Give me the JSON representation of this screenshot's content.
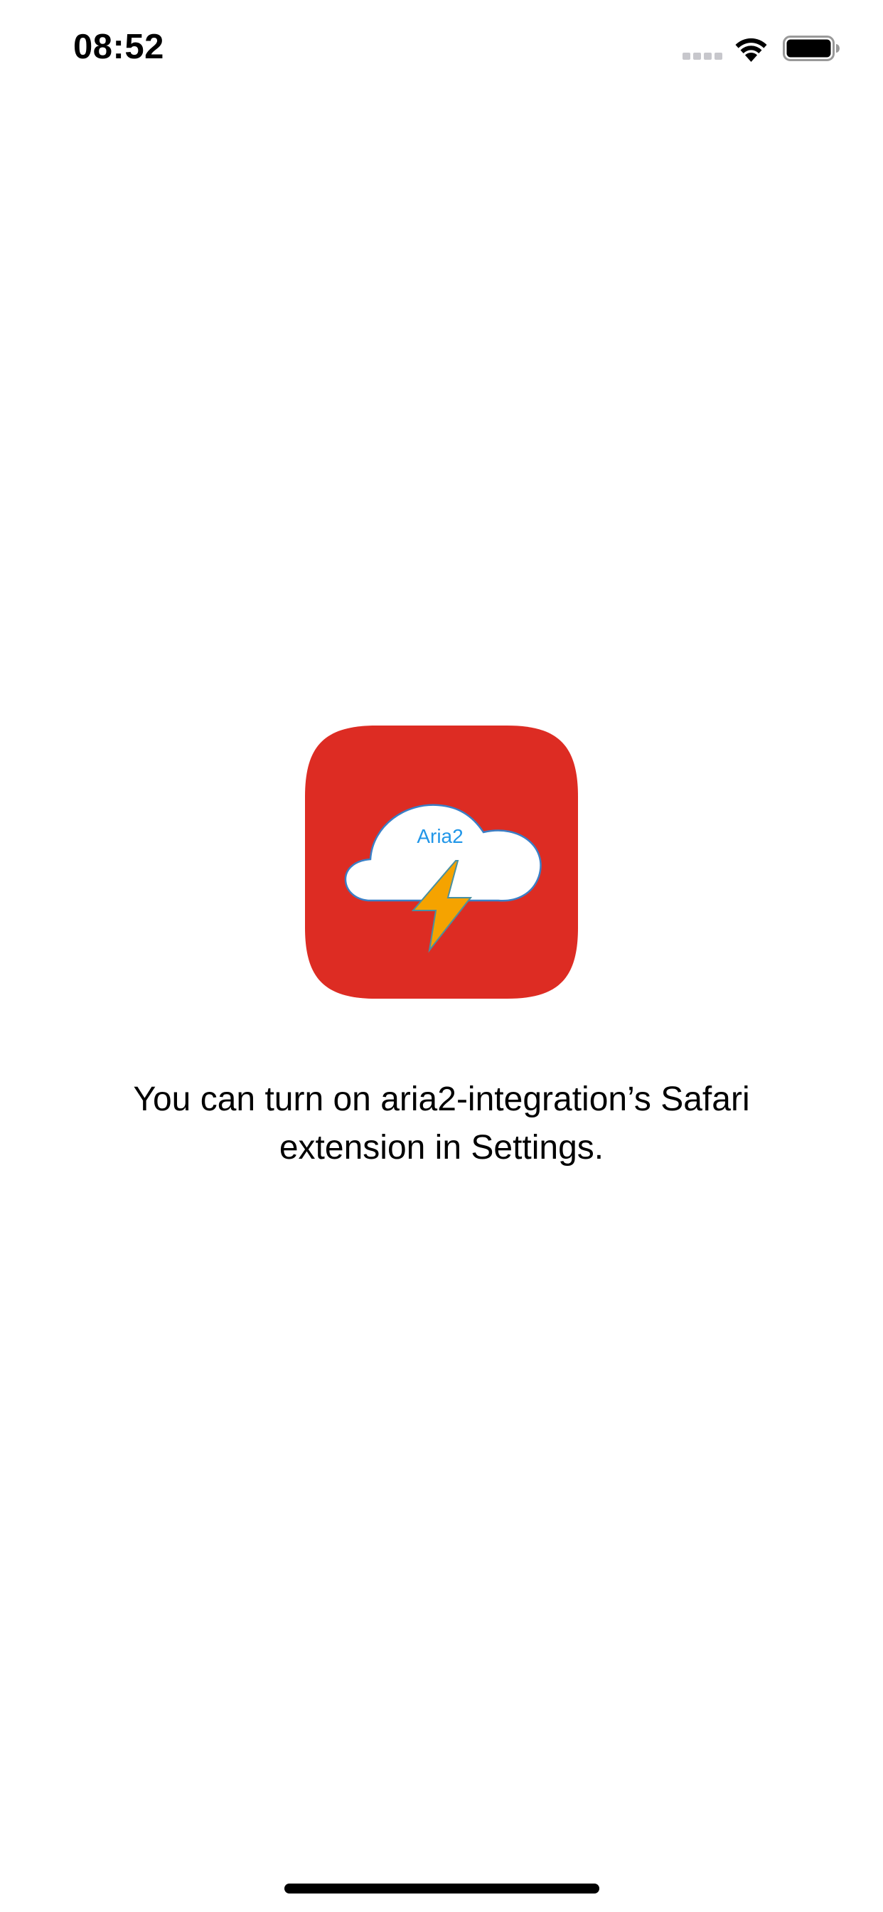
{
  "status_bar": {
    "time": "08:52",
    "signal_icon": "cellular-signal-icon",
    "wifi_icon": "wifi-icon",
    "battery_icon": "battery-icon"
  },
  "app_icon": {
    "icon": "aria2-cloud-lightning-icon",
    "label": "Aria2",
    "colors": {
      "background": "#dd2c23",
      "cloud": "#ffffff",
      "cloud_outline": "#3a7fc6",
      "label": "#2196e8",
      "bolt": "#f5a300"
    }
  },
  "message": "You can turn on aria2-integration’s Safari extension in Settings.",
  "home_indicator_icon": "home-indicator"
}
